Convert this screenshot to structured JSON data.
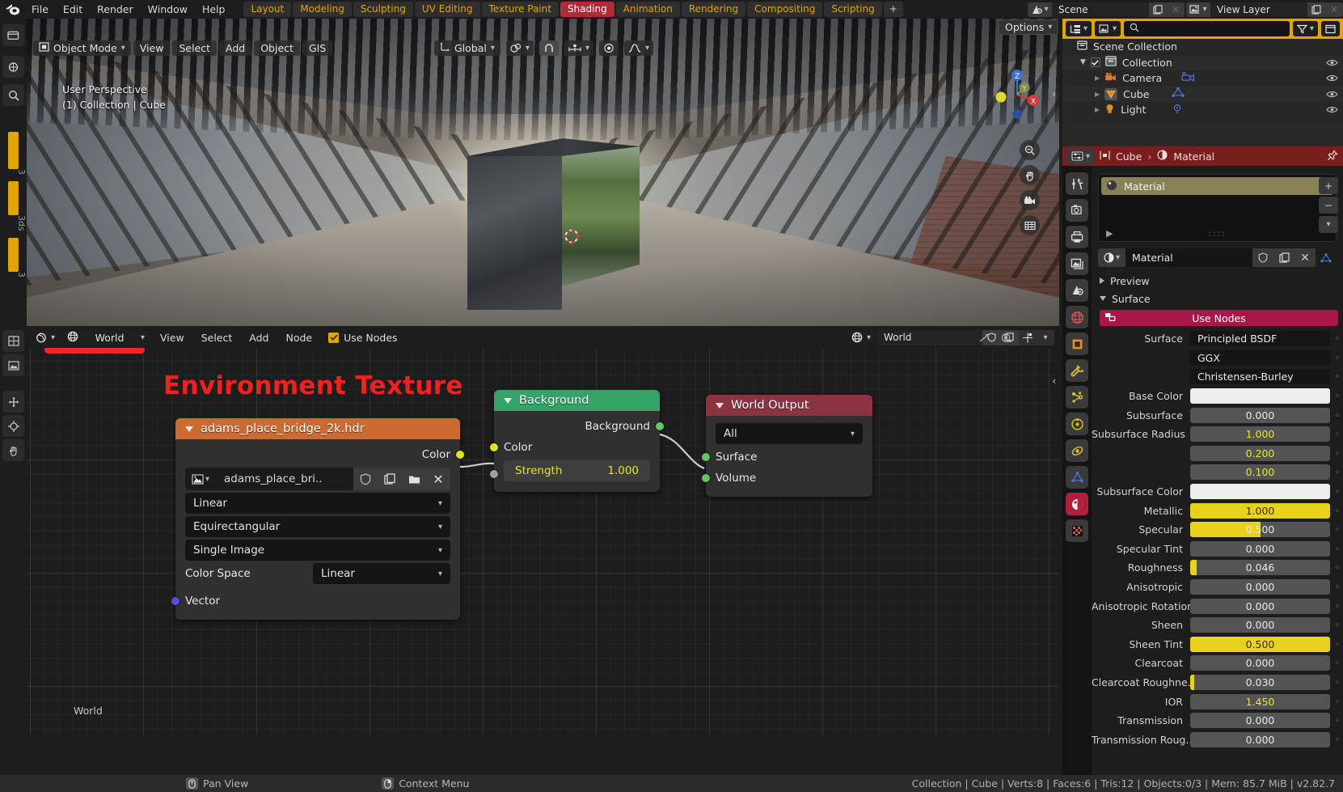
{
  "app": {
    "title": "Blender",
    "version_status": "Collection | Cube | Verts:8 | Faces:6 | Tris:12 | Objects:0/3 | Mem: 85.7 MiB | v2.82.7"
  },
  "topbar": {
    "logo_icon": "blender-logo-icon",
    "menus": [
      "File",
      "Edit",
      "Render",
      "Window",
      "Help"
    ],
    "workspace_tabs": [
      {
        "label": "Layout",
        "active": false
      },
      {
        "label": "Modeling",
        "active": false
      },
      {
        "label": "Sculpting",
        "active": false
      },
      {
        "label": "UV Editing",
        "active": false
      },
      {
        "label": "Texture Paint",
        "active": false
      },
      {
        "label": "Shading",
        "active": true
      },
      {
        "label": "Animation",
        "active": false
      },
      {
        "label": "Rendering",
        "active": false
      },
      {
        "label": "Compositing",
        "active": false
      },
      {
        "label": "Scripting",
        "active": false
      },
      {
        "label": "+",
        "active": false
      }
    ],
    "scene": {
      "icon": "scene-icon",
      "name": "Scene",
      "new_label": "new-scene-icon",
      "unlink_label": "unlink-icon"
    },
    "view_layer": {
      "icon": "view-layer-icon",
      "name": "View Layer",
      "new_label": "new-layer-icon"
    }
  },
  "leftcol": {
    "buttons": [
      "editor-type-icon",
      "render-icon",
      "zoom-icon"
    ],
    "label_3": "3",
    "label_3ds": "3ds",
    "label_3b": "3",
    "bottom_buttons": [
      "uv-icon",
      "image-icon",
      "move-icon",
      "cursor-icon",
      "hand-icon"
    ]
  },
  "viewport": {
    "mode": "Object Mode",
    "mode_icon": "object-mode-icon",
    "menus": [
      "View",
      "Select",
      "Add",
      "Object",
      "GIS"
    ],
    "transform_orientation": "Global",
    "transform_icon": "orientation-icon",
    "snap_icon": "snap-magnet-icon",
    "proportional_icon": "proportional-edit-icon",
    "options_label": "Options",
    "overlay_line1": "User Perspective",
    "overlay_line2": "(1) Collection | Cube",
    "right_icons": [
      "visibility-icon",
      "gizmo-icon",
      "overlays-icon",
      "xray-icon",
      "shading-wireframe-icon",
      "shading-solid-icon",
      "shading-material-icon",
      "shading-rendered-icon"
    ],
    "gizmo_axes": [
      "X",
      "Y",
      "Z"
    ],
    "nav_buttons": [
      "zoom-icon",
      "hand-pan-icon",
      "camera-view-icon",
      "perspective-toggle-icon"
    ]
  },
  "shader_editor": {
    "editor_type_icon": "shader-editor-icon",
    "shader_type": "World",
    "shader_type_icon": "world-icon",
    "menus": [
      "View",
      "Select",
      "Add",
      "Node"
    ],
    "use_nodes_label": "Use Nodes",
    "use_nodes_checked": true,
    "id_world_name": "World",
    "id_world_icon": "world-icon",
    "pin_icon": "pin-icon",
    "footer_label": "World",
    "annotation_text": "Environment Texture",
    "annotation_color": "#f32020",
    "nodes": [
      {
        "name": "adams_place_bridge_2k.hdr",
        "header_color": "#cc6a34",
        "output_socket_label": "Color",
        "image_name": "adams_place_bri..",
        "image_icon": "image-datablock-icon",
        "buttons": [
          "fake-user-shield-icon",
          "new-copy-icon",
          "open-folder-icon",
          "unlink-x-icon"
        ],
        "interpolation": "Linear",
        "projection": "Equirectangular",
        "source": "Single Image",
        "colorspace_label": "Color Space",
        "colorspace_value": "Linear",
        "input_socket_label": "Vector"
      },
      {
        "name": "Background",
        "header_color": "#32a467",
        "output_socket_label": "Background",
        "input_color_label": "Color",
        "strength_label": "Strength",
        "strength_value": "1.000"
      },
      {
        "name": "World Output",
        "header_color": "#8c3341",
        "target_value": "All",
        "input_sockets": [
          "Surface",
          "Volume"
        ]
      }
    ]
  },
  "outliner": {
    "display_mode_icon": "outliner-display-icon",
    "filter_id_icon": "filter-id-icon",
    "search_placeholder": "",
    "search_icon": "search-icon",
    "filter_icon": "filter-funnel-icon",
    "new_collection_icon": "new-collection-icon",
    "rows": [
      {
        "label": "Scene Collection",
        "icon": "scene-collection-icon",
        "indent": 0,
        "has_checkbox": false,
        "has_expand": false,
        "extra_icon": null
      },
      {
        "label": "Collection",
        "icon": "collection-icon",
        "indent": 1,
        "has_checkbox": true,
        "has_expand": true,
        "extra_icon": null
      },
      {
        "label": "Camera",
        "icon": "camera-object-icon",
        "indent": 2,
        "has_checkbox": false,
        "has_expand": true,
        "extra_icon": "camera-data-icon"
      },
      {
        "label": "Cube",
        "icon": "mesh-object-icon",
        "indent": 2,
        "has_checkbox": false,
        "has_expand": true,
        "extra_icon": "mesh-data-icon"
      },
      {
        "label": "Light",
        "icon": "light-object-icon",
        "indent": 2,
        "has_checkbox": false,
        "has_expand": true,
        "extra_icon": "light-data-icon"
      }
    ]
  },
  "properties": {
    "editor_icon": "properties-editor-icon",
    "breadcrumb": [
      {
        "label": "Cube",
        "icon": "object-icon"
      },
      {
        "label": "Material",
        "icon": "material-icon"
      }
    ],
    "pin_icon": "pin-icon",
    "tabs": [
      {
        "name": "tool-tab",
        "icon": "tool-icon",
        "state": "normal"
      },
      {
        "name": "render-tab",
        "icon": "render-camera-icon",
        "state": "normal"
      },
      {
        "name": "output-tab",
        "icon": "printer-icon",
        "state": "normal"
      },
      {
        "name": "view-layer-tab",
        "icon": "images-icon",
        "state": "normal"
      },
      {
        "name": "scene-tab",
        "icon": "scene-cone-icon",
        "state": "normal"
      },
      {
        "name": "world-tab",
        "icon": "world-globe-icon",
        "state": "normal"
      },
      {
        "name": "object-tab",
        "icon": "object-square-icon",
        "state": "normal"
      },
      {
        "name": "modifier-tab",
        "icon": "wrench-icon",
        "state": "normal"
      },
      {
        "name": "particles-tab",
        "icon": "particles-icon",
        "state": "normal"
      },
      {
        "name": "physics-tab",
        "icon": "physics-orbit-icon",
        "state": "normal"
      },
      {
        "name": "constraints-tab",
        "icon": "constraint-icon",
        "state": "normal"
      },
      {
        "name": "data-tab",
        "icon": "mesh-data-triangle-icon",
        "state": "normal"
      },
      {
        "name": "material-tab",
        "icon": "material-sphere-icon",
        "state": "selected-red"
      },
      {
        "name": "texture-tab",
        "icon": "texture-checker-icon",
        "state": "selected"
      }
    ],
    "material_slot": {
      "name": "Material",
      "icon": "material-preview-icon"
    },
    "slot_buttons": [
      "add-slot-icon",
      "remove-slot-icon",
      "slot-specials-icon"
    ],
    "material_id": {
      "icon": "material-icon",
      "name": "Material",
      "buttons": [
        "fake-user-shield-icon",
        "new-copy-icon",
        "unlink-x-icon"
      ],
      "extra_icon": "mesh-data-icon"
    },
    "panels": [
      {
        "label": "Preview",
        "open": false
      },
      {
        "label": "Surface",
        "open": true
      }
    ],
    "use_nodes_label": "Use Nodes",
    "use_nodes_icon": "nodetree-icon",
    "fields": [
      {
        "label": "Surface",
        "value": "Principled BSDF",
        "style": "dropdown"
      },
      {
        "label": "",
        "value": "GGX",
        "style": "dropdown"
      },
      {
        "label": "",
        "value": "Christensen-Burley",
        "style": "dropdown"
      },
      {
        "label": "Base Color",
        "value": "",
        "style": "color",
        "color": "#eeeeee"
      },
      {
        "label": "Subsurface",
        "value": "0.000",
        "style": "slider",
        "fill": 0
      },
      {
        "label": "Subsurface Radius",
        "value": "1.000",
        "style": "number-yellow"
      },
      {
        "label": "",
        "value": "0.200",
        "style": "number-yellow"
      },
      {
        "label": "",
        "value": "0.100",
        "style": "number-yellow"
      },
      {
        "label": "Subsurface Color",
        "value": "",
        "style": "color",
        "color": "#eeeeee"
      },
      {
        "label": "Metallic",
        "value": "1.000",
        "style": "slider",
        "fill": 100
      },
      {
        "label": "Specular",
        "value": "0.500",
        "style": "slider",
        "fill": 50
      },
      {
        "label": "Specular Tint",
        "value": "0.000",
        "style": "slider",
        "fill": 0
      },
      {
        "label": "Roughness",
        "value": "0.046",
        "style": "slider",
        "fill": 4.6
      },
      {
        "label": "Anisotropic",
        "value": "0.000",
        "style": "slider",
        "fill": 0
      },
      {
        "label": "Anisotropic Rotation",
        "value": "0.000",
        "style": "slider",
        "fill": 0
      },
      {
        "label": "Sheen",
        "value": "0.000",
        "style": "slider",
        "fill": 0
      },
      {
        "label": "Sheen Tint",
        "value": "0.500",
        "style": "slider",
        "fill": 50
      },
      {
        "label": "Clearcoat",
        "value": "0.000",
        "style": "slider",
        "fill": 0
      },
      {
        "label": "Clearcoat Roughne..",
        "value": "0.030",
        "style": "slider",
        "fill": 3
      },
      {
        "label": "IOR",
        "value": "1.450",
        "style": "number-yellow"
      },
      {
        "label": "Transmission",
        "value": "0.000",
        "style": "slider",
        "fill": 0
      },
      {
        "label": "Transmission Roug..",
        "value": "0.000",
        "style": "slider",
        "fill": 0
      }
    ]
  },
  "statusbar": {
    "items": [
      {
        "icon": "mouse-middle-icon",
        "label": "Pan View"
      },
      {
        "icon": "mouse-right-icon",
        "label": "Context Menu"
      }
    ],
    "right": "Collection | Cube | Verts:8 | Faces:6 | Tris:12 | Objects:0/3 | Mem: 85.7 MiB | v2.82.7"
  }
}
